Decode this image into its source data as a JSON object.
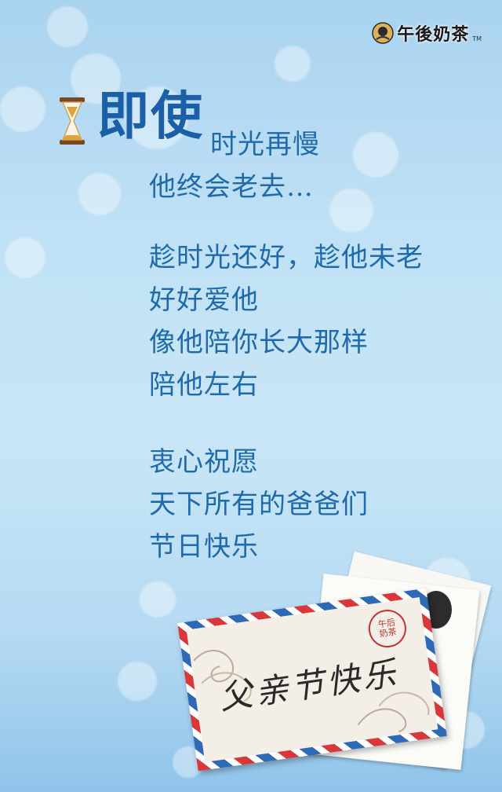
{
  "brand": {
    "name": "午後奶茶",
    "tm": "TM",
    "icon": "lady-logo-icon"
  },
  "heading": {
    "emphasis": "即使",
    "rest": "时光再慢"
  },
  "poem": {
    "line2": "他终会老去…",
    "stanza1": [
      "趁时光还好，趁他未老",
      "好好爱他",
      "像他陪你长大那样",
      "陪他左右"
    ],
    "stanza2": [
      "衷心祝愿",
      "天下所有的爸爸们",
      "节日快乐"
    ]
  },
  "envelope": {
    "text": "父亲节快乐",
    "stamp": "午后\n奶茶"
  },
  "colors": {
    "text": "#1e6aab",
    "title": "#1b5fa8",
    "background": "#bfe0f5"
  }
}
